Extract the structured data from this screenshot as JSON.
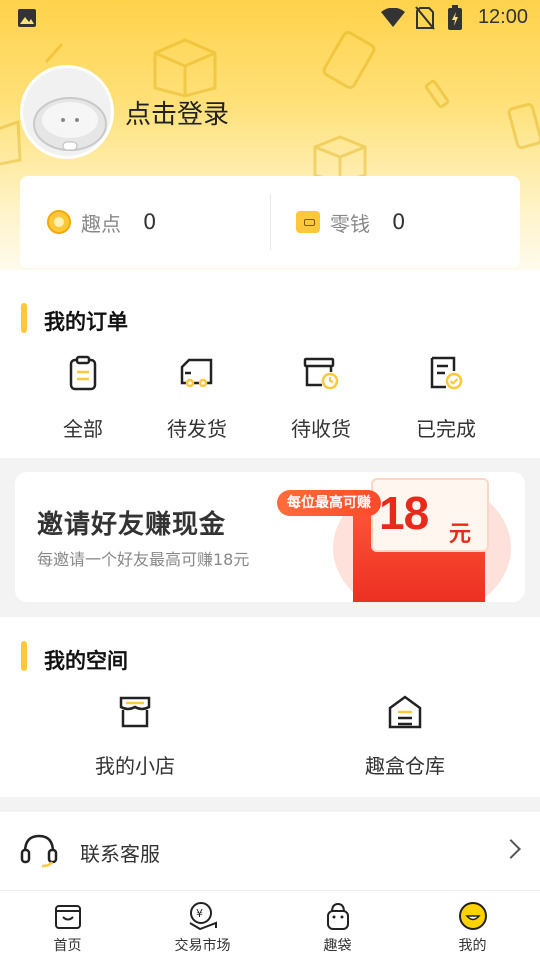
{
  "status_bar": {
    "time": "12:00"
  },
  "profile": {
    "login_text": "点击登录"
  },
  "wallet": {
    "points_label": "趣点",
    "points_value": "0",
    "cash_label": "零钱",
    "cash_value": "0"
  },
  "orders": {
    "title": "我的订单",
    "items": [
      {
        "label": "全部",
        "icon": "clipboard-icon"
      },
      {
        "label": "待发货",
        "icon": "truck-icon"
      },
      {
        "label": "待收货",
        "icon": "box-clock-icon"
      },
      {
        "label": "已完成",
        "icon": "document-check-icon"
      }
    ]
  },
  "banner": {
    "title": "邀请好友赚现金",
    "subtitle": "每邀请一个好友最高可赚18元",
    "tag": "每位最高可赚",
    "amount": "18",
    "unit": "元"
  },
  "space": {
    "title": "我的空间",
    "items": [
      {
        "label": "我的小店",
        "icon": "store-icon"
      },
      {
        "label": "趣盒仓库",
        "icon": "warehouse-icon"
      }
    ]
  },
  "service": {
    "label": "联系客服",
    "icon": "headset-icon"
  },
  "tabbar": {
    "items": [
      {
        "label": "首页",
        "icon": "home-box-icon"
      },
      {
        "label": "交易市场",
        "icon": "market-icon"
      },
      {
        "label": "趣袋",
        "icon": "bag-icon"
      },
      {
        "label": "我的",
        "icon": "smiley-icon"
      }
    ]
  },
  "colors": {
    "accent": "#ffc83a",
    "banner_red": "#e82a1b"
  }
}
